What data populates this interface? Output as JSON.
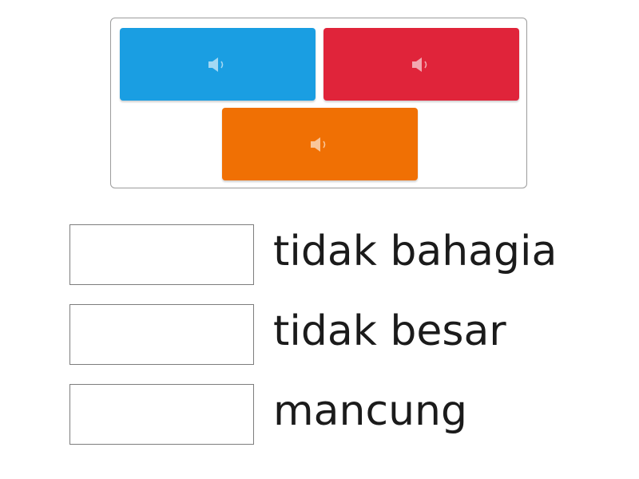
{
  "tray": {
    "tiles": [
      {
        "color": "#1a9ee2",
        "icon": "speaker-icon"
      },
      {
        "color": "#e0243a",
        "icon": "speaker-icon"
      },
      {
        "color": "#f07004",
        "icon": "speaker-icon"
      }
    ]
  },
  "answers": [
    {
      "label": "tidak bahagia"
    },
    {
      "label": "tidak besar"
    },
    {
      "label": "mancung"
    }
  ]
}
